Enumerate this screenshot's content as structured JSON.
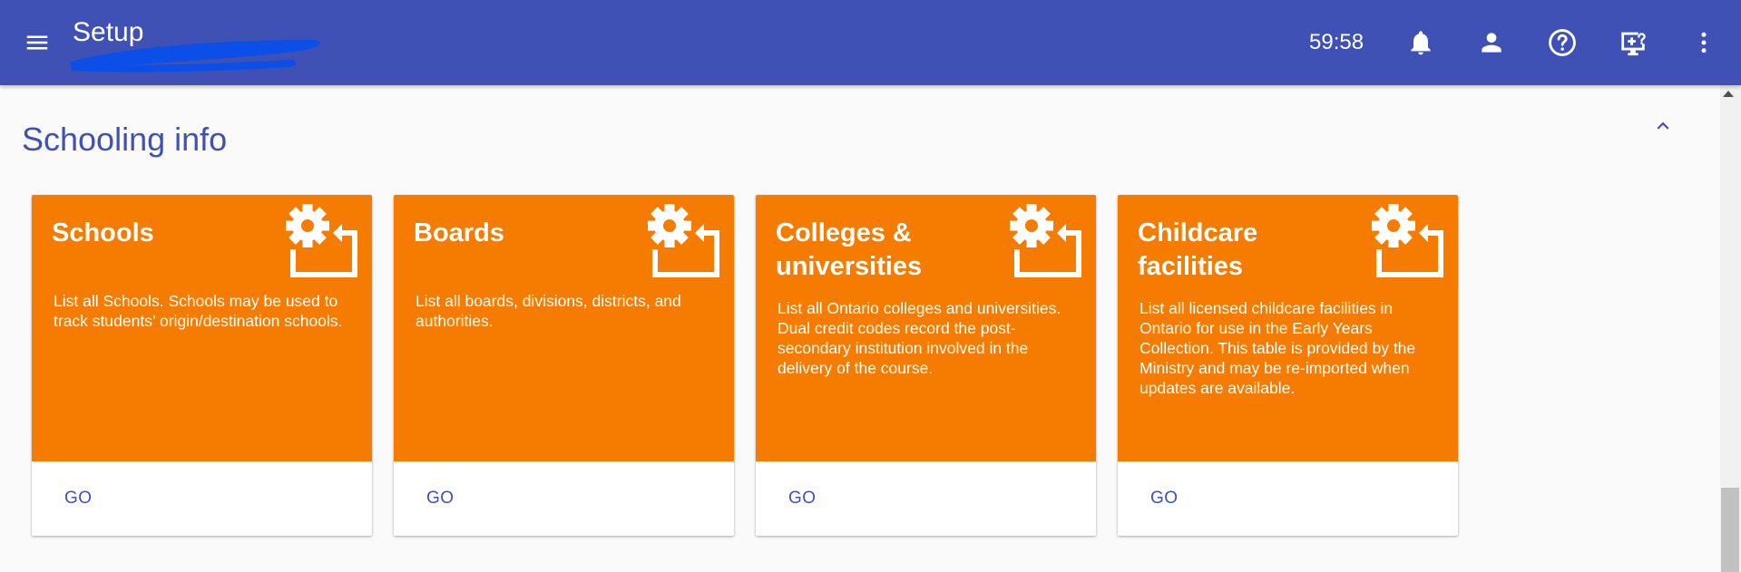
{
  "header": {
    "title": "Setup",
    "timer": "59:58",
    "background": "#3f51b5",
    "icons": [
      "menu-icon",
      "bell-icon",
      "person-icon",
      "help-icon",
      "screen-help-icon",
      "more-vert-icon"
    ]
  },
  "section": {
    "title": "Schooling info",
    "collapse_icon": "chevron-up-icon"
  },
  "cards": [
    {
      "title": "Schools",
      "description": "List all Schools. Schools may be used to track students’ origin/destination schools.",
      "action": "GO"
    },
    {
      "title": "Boards",
      "description": "List all boards, divisions, districts, and authorities.",
      "action": "GO"
    },
    {
      "title": "Colleges & universities",
      "description": "List all Ontario colleges and universities. Dual credit codes record the post-secondary institution involved in the delivery of the course.",
      "action": "GO"
    },
    {
      "title": "Childcare facilities",
      "description": "List all licensed childcare facilities in Ontario for use in the Early Years Collection. This table is provided by the Ministry and may be re-imported when updates are available.",
      "action": "GO"
    }
  ],
  "colors": {
    "primary": "#3f51b5",
    "card_accent": "#f57c00",
    "redaction": "#0b4ee8"
  }
}
